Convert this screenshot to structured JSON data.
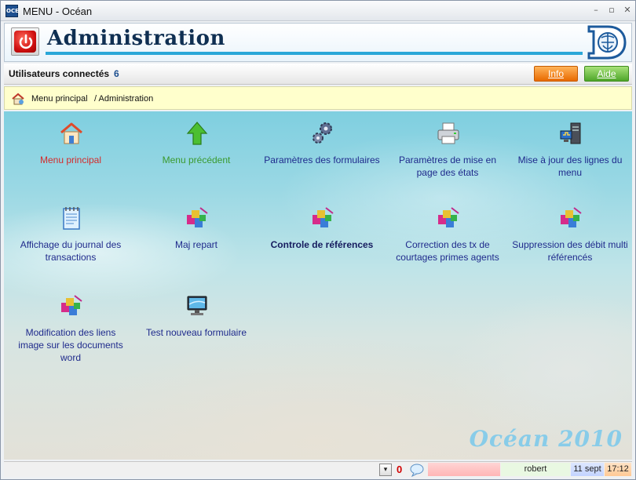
{
  "window": {
    "title": "MENU - Océan"
  },
  "header": {
    "title": "Administration"
  },
  "users": {
    "label": "Utilisateurs connectés",
    "count": "6"
  },
  "buttons": {
    "info": "Info",
    "aide": "Aide"
  },
  "breadcrumb": {
    "home": "Menu principal",
    "current": "/ Administration"
  },
  "tiles": [
    {
      "label": "Menu principal",
      "icon": "home-icon"
    },
    {
      "label": "Menu précédent",
      "icon": "up-arrow-icon"
    },
    {
      "label": "Paramètres des formulaires",
      "icon": "gears-icon"
    },
    {
      "label": "Paramètres de mise en page des états",
      "icon": "printer-icon"
    },
    {
      "label": "Mise à jour des lignes du menu",
      "icon": "server-icon"
    },
    {
      "label": "Affichage du journal des transactions",
      "icon": "notepad-icon"
    },
    {
      "label": "Maj repart",
      "icon": "package-icon"
    },
    {
      "label": "Controle de références",
      "icon": "package-icon"
    },
    {
      "label": "Correction des tx de courtages primes agents",
      "icon": "package-icon"
    },
    {
      "label": "Suppression des débit multi référencés",
      "icon": "package-icon"
    },
    {
      "label": "Modification des liens image sur les documents word",
      "icon": "package-icon"
    },
    {
      "label": "Test nouveau formulaire",
      "icon": "monitor-icon"
    }
  ],
  "brand": "Océan 2010",
  "status": {
    "alerts": "0",
    "user": "robert",
    "date": "11 sept",
    "time": "17:12"
  }
}
